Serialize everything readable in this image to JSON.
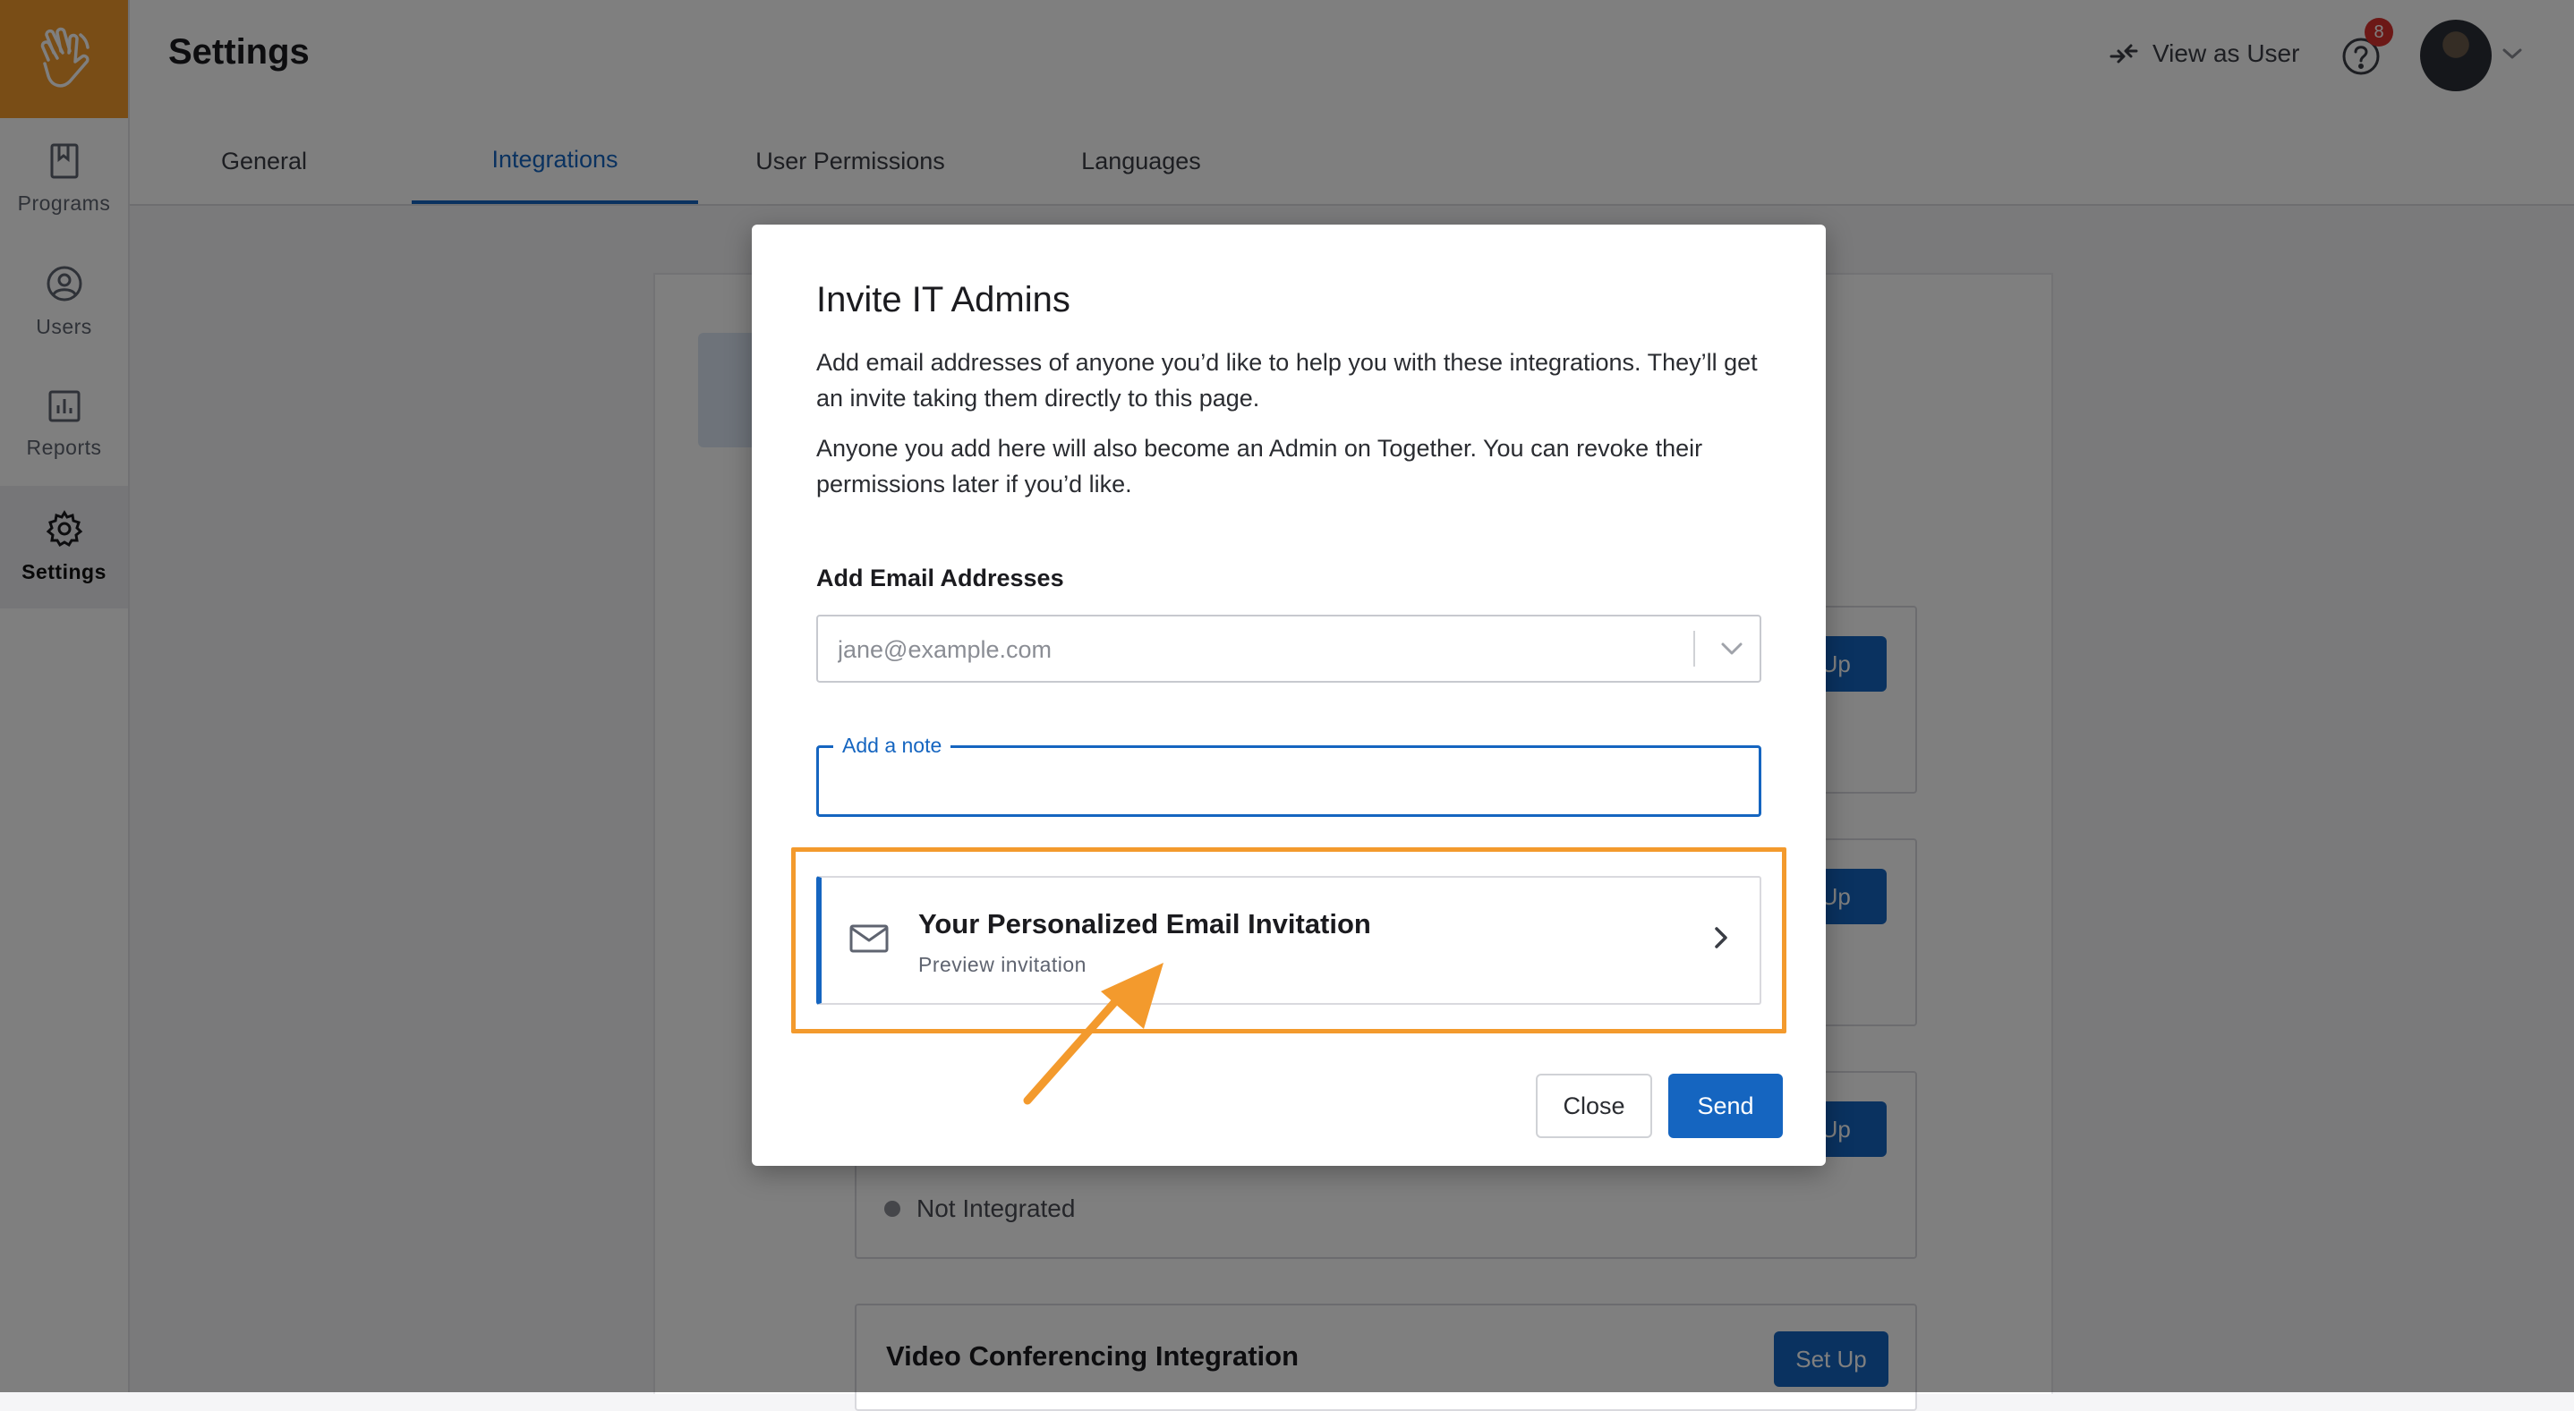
{
  "app": {
    "brand_color": "#f39a2d",
    "accent_color": "#1565c0",
    "logo_icon": "waving-hand-icon"
  },
  "sidebar": {
    "items": [
      {
        "label": "Programs",
        "icon": "bookmark-icon",
        "active": false
      },
      {
        "label": "Users",
        "icon": "user-circle-icon",
        "active": false
      },
      {
        "label": "Reports",
        "icon": "bar-chart-icon",
        "active": false
      },
      {
        "label": "Settings",
        "icon": "gear-icon",
        "active": true
      }
    ]
  },
  "header": {
    "title": "Settings",
    "view_as_user": "View as User",
    "help_badge_count": "8"
  },
  "tabs": [
    {
      "label": "General",
      "active": false
    },
    {
      "label": "Integrations",
      "active": true
    },
    {
      "label": "User Permissions",
      "active": false
    },
    {
      "label": "Languages",
      "active": false
    }
  ],
  "background": {
    "setup_label": "Set Up",
    "partial_setup_label": "t Up",
    "status_text": "Not Integrated",
    "video_card_title": "Video Conferencing Integration"
  },
  "modal": {
    "title": "Invite IT Admins",
    "paragraph1": "Add email addresses of anyone you’d like to help you with these integrations. They’ll get an invite taking them directly to this page.",
    "paragraph2": "Anyone you add here will also become an Admin on Together. You can revoke their permissions later if you’d like.",
    "email_label": "Add Email Addresses",
    "email_placeholder": "jane@example.com",
    "note_label": "Add a note",
    "note_value": "",
    "preview_title": "Your Personalized Email Invitation",
    "preview_subtitle": "Preview invitation",
    "close_label": "Close",
    "send_label": "Send",
    "highlight_color": "#f39a2d"
  }
}
